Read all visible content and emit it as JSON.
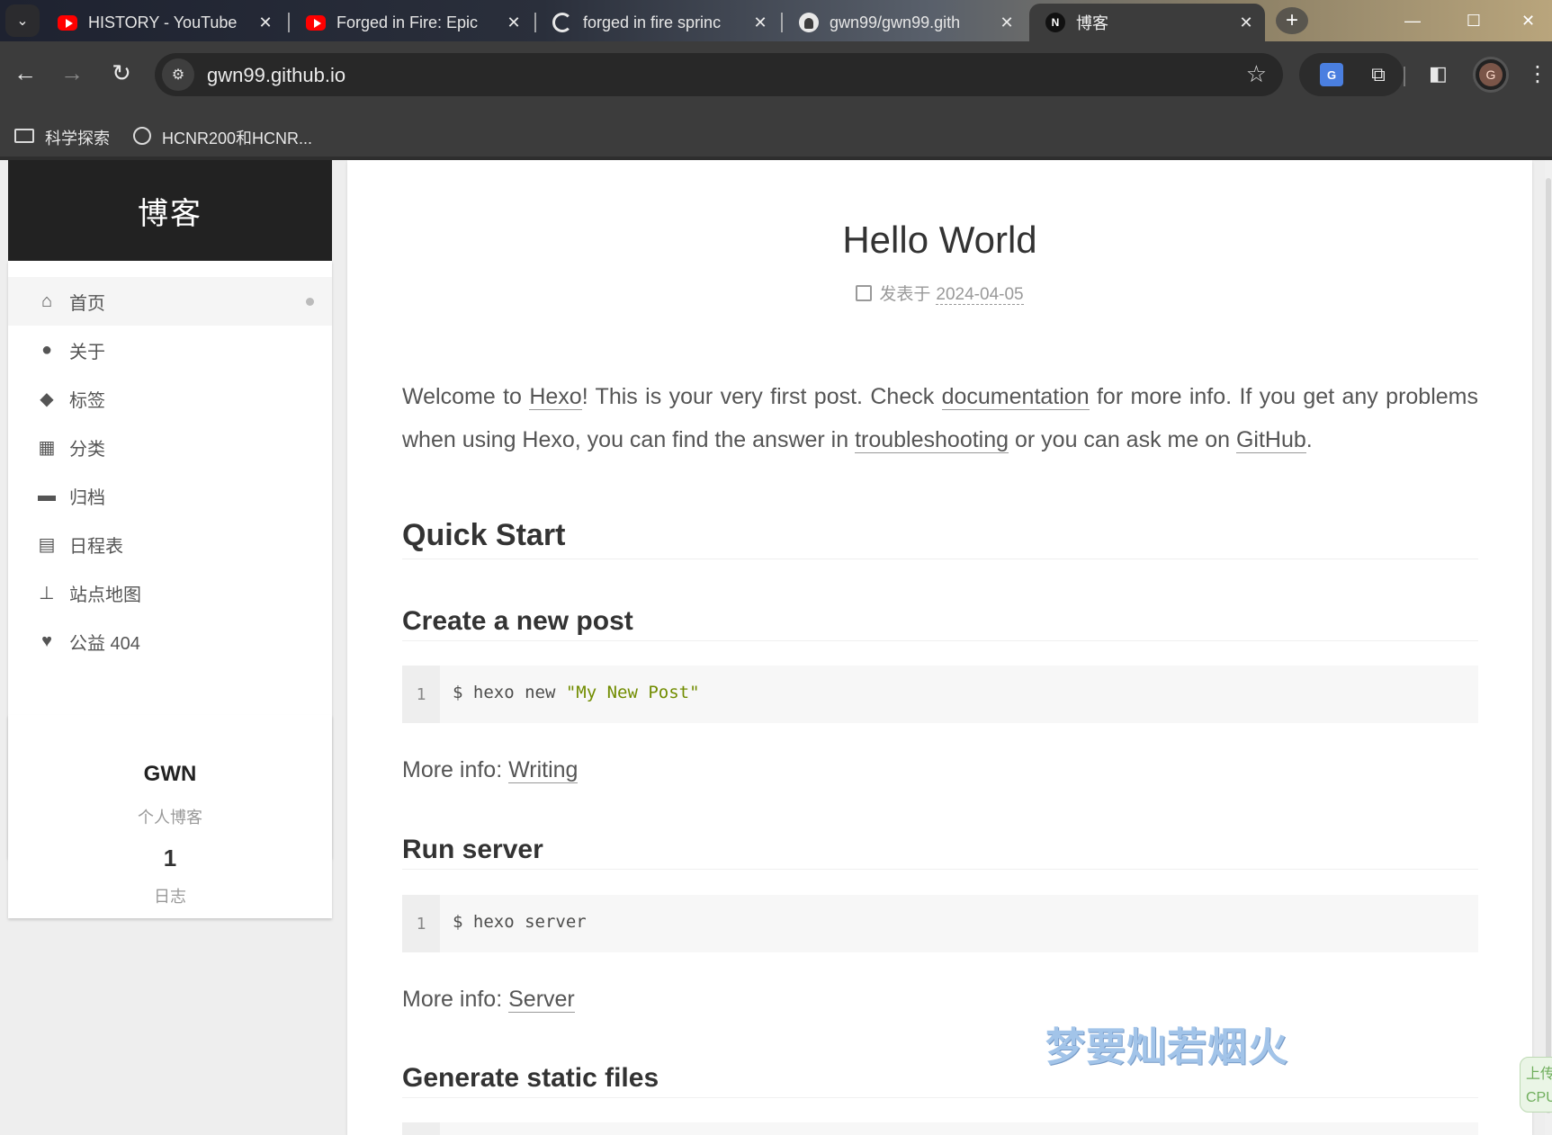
{
  "browser": {
    "tabs": [
      {
        "title": "HISTORY - YouTube",
        "icon": "youtube-icon"
      },
      {
        "title": "Forged in Fire: Epic",
        "icon": "youtube-icon"
      },
      {
        "title": "forged in fire sprinc",
        "icon": "google-icon"
      },
      {
        "title": "gwn99/gwn99.gith",
        "icon": "github-icon"
      },
      {
        "title": "博客",
        "icon": "hexo-n-icon",
        "active": true
      }
    ],
    "new_tab_label": "+",
    "close_glyph": "✕",
    "url": "gwn99.github.io",
    "profile_initial": "G",
    "bookmarks": [
      {
        "label": "科学探索",
        "icon": "folder-icon"
      },
      {
        "label": "HCNR200和HCNR...",
        "icon": "globe-icon"
      }
    ]
  },
  "sidebar": {
    "site_title": "博客",
    "menu": [
      {
        "label": "首页",
        "icon": "home-icon",
        "active": true
      },
      {
        "label": "关于",
        "icon": "user-icon"
      },
      {
        "label": "标签",
        "icon": "tags-icon"
      },
      {
        "label": "分类",
        "icon": "th-icon"
      },
      {
        "label": "归档",
        "icon": "archive-icon"
      },
      {
        "label": "日程表",
        "icon": "calendar-icon"
      },
      {
        "label": "站点地图",
        "icon": "sitemap-icon"
      },
      {
        "label": "公益 404",
        "icon": "heartbeat-icon"
      }
    ],
    "author": {
      "name": "GWN",
      "description": "个人博客",
      "posts_count": "1",
      "posts_label": "日志"
    }
  },
  "post": {
    "title": "Hello World",
    "meta_label": "发表于",
    "date": "2024-04-05",
    "intro": {
      "p1": "Welcome to ",
      "link_hexo": "Hexo",
      "p2": "! This is your very first post. Check ",
      "link_docs": "documentation",
      "p3": " for more info. If you get any problems when using Hexo, you can find the answer in ",
      "link_trouble": "troubleshooting",
      "p4": " or you can ask me on ",
      "link_github": "GitHub",
      "p5": "."
    },
    "quick_start": "Quick Start",
    "create_post": {
      "heading": "Create a new post",
      "line_no": "1",
      "cmd": "$ hexo new ",
      "arg": "\"My New Post\"",
      "more_label": "More info: ",
      "more_link": "Writing"
    },
    "run_server": {
      "heading": "Run server",
      "line_no": "1",
      "cmd": "$ hexo server",
      "more_label": "More info: ",
      "more_link": "Server"
    },
    "generate": {
      "heading": "Generate static files"
    }
  },
  "overlay": {
    "watermark": "梦要灿若烟火",
    "side_widget_top": "上传",
    "side_widget_bottom": "CPU"
  }
}
